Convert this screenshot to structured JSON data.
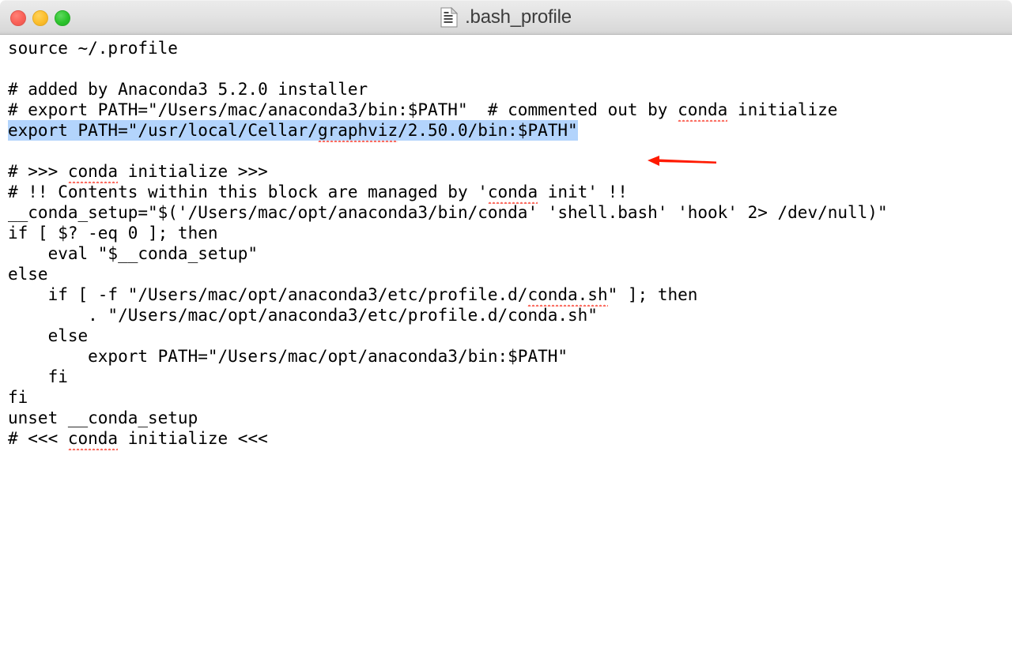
{
  "window": {
    "title": ".bash_profile",
    "doc_icon": "document-icon",
    "traffic_lights": [
      {
        "name": "close",
        "label": "Close",
        "color": "#fa6057"
      },
      {
        "name": "minimize",
        "label": "Minimize",
        "color": "#fcbe2c"
      },
      {
        "name": "zoom",
        "label": "Zoom",
        "color": "#2cc32c"
      }
    ]
  },
  "editor": {
    "selection_color": "#b3d4fc",
    "spellcheck_color": "#fa6a5e",
    "annotation_arrow_color": "#ff1a00",
    "lines": [
      {
        "n": 1,
        "text": "source ~/.profile"
      },
      {
        "n": 2,
        "text": ""
      },
      {
        "n": 3,
        "text": "# added by Anaconda3 5.2.0 installer"
      },
      {
        "n": 4,
        "pre": "# export PATH=\"/Users/mac/anaconda3/bin:$PATH\"  # commented out by ",
        "misspelled": "conda",
        "post": " initialize"
      },
      {
        "n": 5,
        "selected": true,
        "pre": "export PATH=\"/usr/local/Cellar/",
        "misspelled": "graphviz",
        "post": "/2.50.0/bin:$PATH\""
      },
      {
        "n": 6,
        "text": ""
      },
      {
        "n": 7,
        "pre": "# >>> ",
        "misspelled": "conda",
        "post": " initialize >>>"
      },
      {
        "n": 8,
        "pre": "# !! Contents within this block are managed by '",
        "misspelled": "conda",
        "post": " init' !!"
      },
      {
        "n": 9,
        "text": "__conda_setup=\"$('/Users/mac/opt/anaconda3/bin/conda' 'shell.bash' 'hook' 2> /dev/null)\""
      },
      {
        "n": 10,
        "text": "if [ $? -eq 0 ]; then"
      },
      {
        "n": 11,
        "text": "    eval \"$__conda_setup\""
      },
      {
        "n": 12,
        "text": "else"
      },
      {
        "n": 13,
        "pre": "    if [ -f \"/Users/mac/opt/anaconda3/etc/profile.d/",
        "misspelled": "conda.sh",
        "post": "\" ]; then"
      },
      {
        "n": 14,
        "text": "        . \"/Users/mac/opt/anaconda3/etc/profile.d/conda.sh\""
      },
      {
        "n": 15,
        "text": "    else"
      },
      {
        "n": 16,
        "text": "        export PATH=\"/Users/mac/opt/anaconda3/bin:$PATH\""
      },
      {
        "n": 17,
        "text": "    fi"
      },
      {
        "n": 18,
        "text": "fi"
      },
      {
        "n": 19,
        "text": "unset __conda_setup"
      },
      {
        "n": 20,
        "pre": "# <<< ",
        "misspelled": "conda",
        "post": " initialize <<<"
      }
    ]
  },
  "annotation": {
    "arrow_name": "red-left-arrow",
    "points_to_line": 5,
    "direction": "left"
  }
}
